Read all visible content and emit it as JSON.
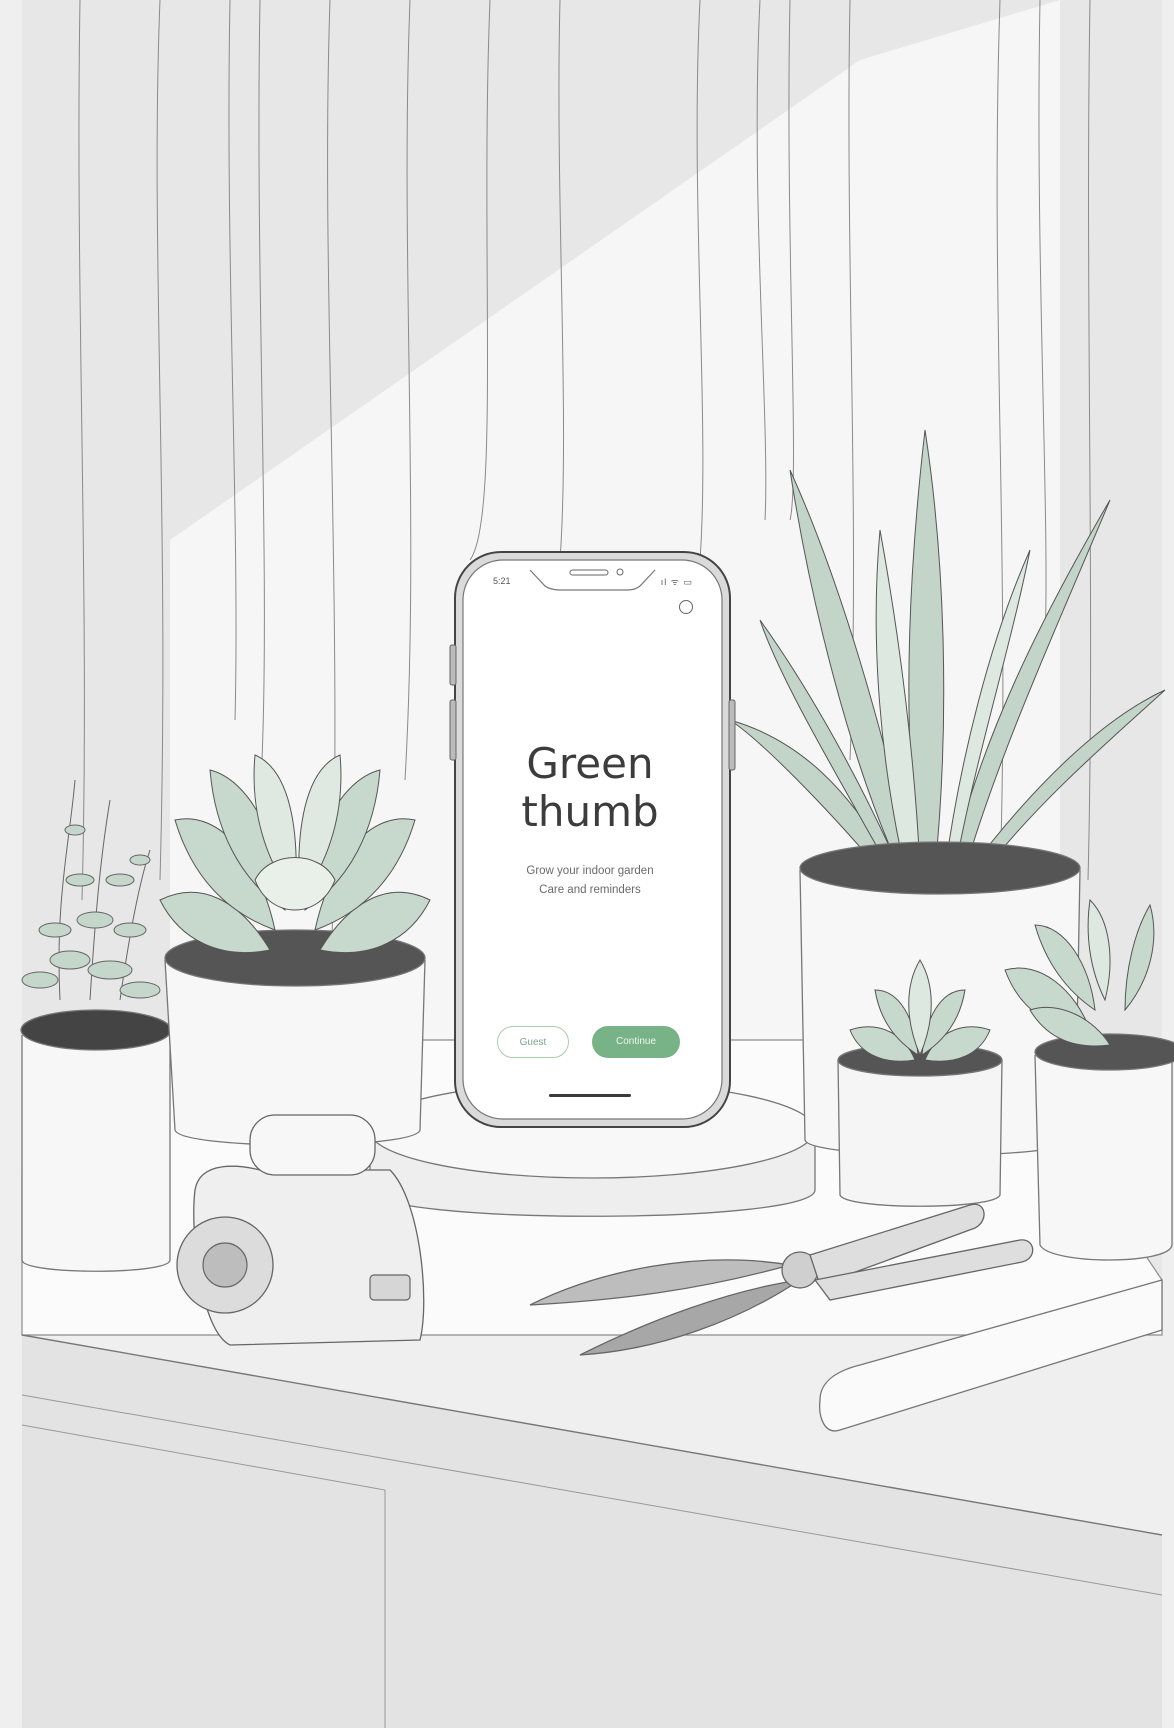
{
  "status_bar": {
    "time": "5:21",
    "icons": "ıl ᯤ ▭"
  },
  "screen": {
    "title": "Green\nthumb",
    "subtitle_line1": "Grow your indoor garden",
    "subtitle_line2": "Care and reminders"
  },
  "buttons": {
    "secondary_label": "Guest",
    "primary_label": "Continue"
  },
  "colors": {
    "accent_green": "#77b387",
    "leaf_green": "#c7d8cc",
    "line": "#555555",
    "background": "#f1f1f1"
  },
  "icons": {
    "menu": "profile-icon"
  }
}
